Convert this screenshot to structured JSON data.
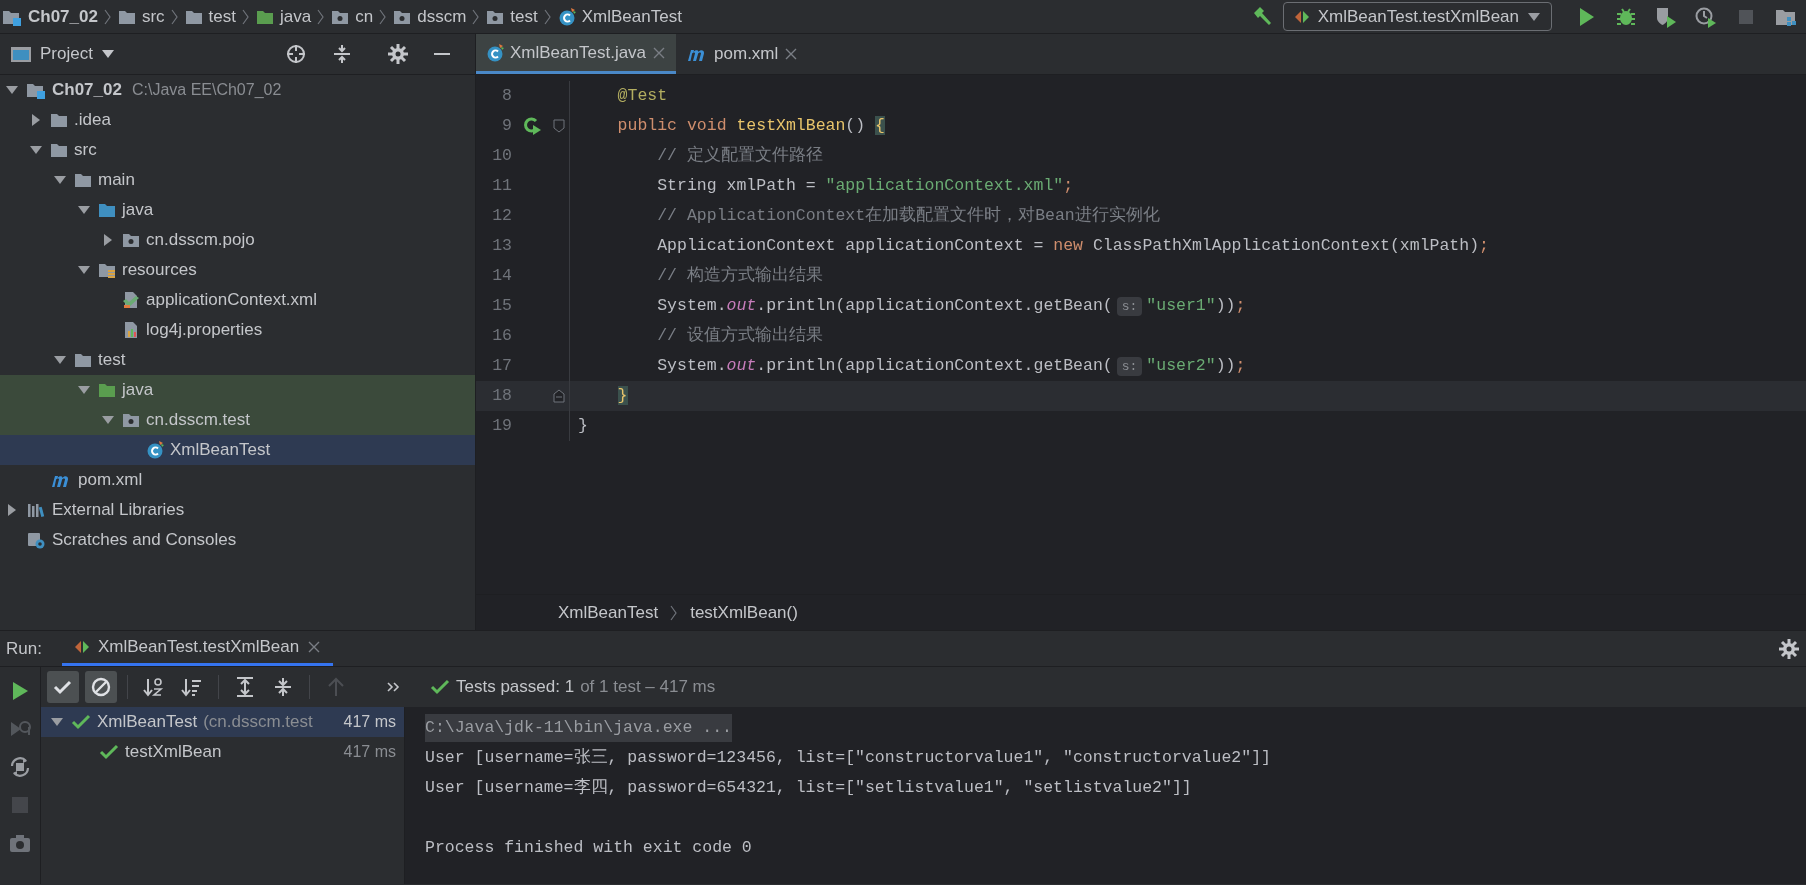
{
  "nav_bar": {
    "breadcrumbs": [
      {
        "label": "Ch07_02",
        "kind": "module"
      },
      {
        "label": "src",
        "kind": "folder"
      },
      {
        "label": "test",
        "kind": "folder"
      },
      {
        "label": "java",
        "kind": "test_folder"
      },
      {
        "label": "cn",
        "kind": "package"
      },
      {
        "label": "dsscm",
        "kind": "package"
      },
      {
        "label": "test",
        "kind": "package"
      },
      {
        "label": "XmlBeanTest",
        "kind": "class"
      }
    ],
    "run_config": "XmlBeanTest.testXmlBean",
    "actions": [
      {
        "kind": "run",
        "disabled": false
      },
      {
        "kind": "debug",
        "disabled": false
      },
      {
        "kind": "coverage",
        "disabled": false
      },
      {
        "kind": "profile",
        "disabled": false
      },
      {
        "kind": "stop",
        "disabled": true
      },
      {
        "kind": "structure",
        "disabled": false
      }
    ]
  },
  "project_panel": {
    "title": "Project",
    "tree": [
      {
        "label": "Ch07_02",
        "path": "C:\\Java EE\\Ch07_02",
        "kind": "module",
        "expanded": true,
        "selected": false,
        "test_scope": false,
        "children": [
          {
            "label": ".idea",
            "kind": "folder",
            "expanded": false,
            "selected": false,
            "test_scope": false
          },
          {
            "label": "src",
            "kind": "folder",
            "expanded": true,
            "selected": false,
            "test_scope": false,
            "children": [
              {
                "label": "main",
                "kind": "folder",
                "expanded": true,
                "selected": false,
                "test_scope": false,
                "children": [
                  {
                    "label": "java",
                    "kind": "source_folder",
                    "expanded": true,
                    "selected": false,
                    "test_scope": false,
                    "children": [
                      {
                        "label": "cn.dsscm.pojo",
                        "kind": "package",
                        "expanded": false,
                        "selected": false,
                        "test_scope": false
                      }
                    ]
                  },
                  {
                    "label": "resources",
                    "kind": "resources_folder",
                    "expanded": true,
                    "selected": false,
                    "test_scope": false,
                    "children": [
                      {
                        "label": "applicationContext.xml",
                        "kind": "xml",
                        "selected": false,
                        "test_scope": false
                      },
                      {
                        "label": "log4j.properties",
                        "kind": "properties",
                        "selected": false,
                        "test_scope": false
                      }
                    ]
                  }
                ]
              },
              {
                "label": "test",
                "kind": "folder",
                "expanded": true,
                "selected": false,
                "test_scope": false,
                "children": [
                  {
                    "label": "java",
                    "kind": "test_folder",
                    "expanded": true,
                    "selected": false,
                    "test_scope": true,
                    "children": [
                      {
                        "label": "cn.dsscm.test",
                        "kind": "package",
                        "expanded": true,
                        "selected": false,
                        "test_scope": true,
                        "children": [
                          {
                            "label": "XmlBeanTest",
                            "kind": "class",
                            "selected": true
                          }
                        ]
                      }
                    ]
                  }
                ]
              }
            ]
          },
          {
            "label": "pom.xml",
            "kind": "maven",
            "selected": false,
            "test_scope": false
          }
        ]
      },
      {
        "label": "External Libraries",
        "kind": "libraries",
        "expanded": false,
        "selected": false,
        "test_scope": false
      },
      {
        "label": "Scratches and Consoles",
        "kind": "scratches",
        "selected": false,
        "test_scope": false
      }
    ]
  },
  "editor": {
    "tabs": [
      {
        "label": "XmlBeanTest.java",
        "kind": "class",
        "selected": true
      },
      {
        "label": "pom.xml",
        "kind": "maven",
        "selected": false
      }
    ],
    "lines": [
      {
        "number": "8",
        "current": false,
        "tokens": [
          {
            "kind": "annotation",
            "text": "    @Test"
          }
        ]
      },
      {
        "number": "9",
        "current": false,
        "run_marker": true,
        "fold_open": true,
        "tokens": [
          {
            "kind": "keyword",
            "text": "    public void "
          },
          {
            "kind": "method",
            "text": "testXmlBean"
          },
          {
            "kind": "plain",
            "text": "() "
          },
          {
            "kind": "brace",
            "text": "{"
          }
        ]
      },
      {
        "number": "10",
        "current": false,
        "tokens": [
          {
            "kind": "comment",
            "text": "        // 定义配置文件路径"
          }
        ]
      },
      {
        "number": "11",
        "current": false,
        "tokens": [
          {
            "kind": "plain",
            "text": "        String xmlPath = "
          },
          {
            "kind": "string",
            "text": "\"applicationContext.xml\""
          },
          {
            "kind": "punct",
            "text": ";"
          }
        ]
      },
      {
        "number": "12",
        "current": false,
        "tokens": [
          {
            "kind": "comment",
            "text": "        // ApplicationContext在加载配置文件时，对Bean进行实例化"
          }
        ]
      },
      {
        "number": "13",
        "current": false,
        "tokens": [
          {
            "kind": "plain",
            "text": "        ApplicationContext applicationContext = "
          },
          {
            "kind": "keyword",
            "text": "new "
          },
          {
            "kind": "plain",
            "text": "ClassPathXmlApplicationContext(xmlPath)"
          },
          {
            "kind": "punct",
            "text": ";"
          }
        ]
      },
      {
        "number": "14",
        "current": false,
        "tokens": [
          {
            "kind": "comment",
            "text": "        // 构造方式输出结果"
          }
        ]
      },
      {
        "number": "15",
        "current": false,
        "tokens": [
          {
            "kind": "plain",
            "text": "        System."
          },
          {
            "kind": "field",
            "text": "out"
          },
          {
            "kind": "plain",
            "text": ".println(applicationContext.getBean("
          },
          {
            "kind": "hint",
            "text": "s:"
          },
          {
            "kind": "string",
            "text": "\"user1\""
          },
          {
            "kind": "plain",
            "text": "))"
          },
          {
            "kind": "punct",
            "text": ";"
          }
        ]
      },
      {
        "number": "16",
        "current": false,
        "tokens": [
          {
            "kind": "comment",
            "text": "        // 设值方式输出结果"
          }
        ]
      },
      {
        "number": "17",
        "current": false,
        "tokens": [
          {
            "kind": "plain",
            "text": "        System."
          },
          {
            "kind": "field",
            "text": "out"
          },
          {
            "kind": "plain",
            "text": ".println(applicationContext.getBean("
          },
          {
            "kind": "hint",
            "text": "s:"
          },
          {
            "kind": "string",
            "text": "\"user2\""
          },
          {
            "kind": "plain",
            "text": "))"
          },
          {
            "kind": "punct",
            "text": ";"
          }
        ]
      },
      {
        "number": "18",
        "current": true,
        "fold_close": true,
        "tokens": [
          {
            "kind": "brace",
            "text": "    }"
          }
        ]
      },
      {
        "number": "19",
        "current": false,
        "tokens": [
          {
            "kind": "plain",
            "text": "}"
          }
        ]
      }
    ],
    "breadcrumbs": [
      "XmlBeanTest",
      "testXmlBean()"
    ]
  },
  "run_panel": {
    "label": "Run:",
    "tabs": [
      {
        "label": "XmlBeanTest.testXmlBean",
        "selected": true
      }
    ],
    "side_actions": [
      {
        "kind": "rerun",
        "disabled": false
      },
      {
        "kind": "rerun_failed",
        "disabled": true
      },
      {
        "kind": "auto_test",
        "disabled": false
      },
      {
        "kind": "stop",
        "disabled": true
      },
      {
        "kind": "camera",
        "disabled": false
      }
    ],
    "toolbar": [
      {
        "kind": "show_passed",
        "on": true,
        "disabled": false
      },
      {
        "kind": "show_ignored",
        "on": true,
        "disabled": false
      },
      {
        "kind": "sort_alpha",
        "on": false,
        "disabled": false
      },
      {
        "kind": "sort_duration",
        "on": false,
        "disabled": false
      },
      {
        "kind": "expand_all",
        "on": false,
        "disabled": false
      },
      {
        "kind": "collapse_all",
        "on": false,
        "disabled": false
      },
      {
        "kind": "previous",
        "on": false,
        "disabled": true
      },
      {
        "kind": "more",
        "on": false,
        "disabled": false
      }
    ],
    "status": {
      "main": "Tests passed: 1",
      "detail": "of 1 test – 417 ms"
    },
    "tests": [
      {
        "label": "XmlBeanTest",
        "detail": "(cn.dsscm.test",
        "time": "417 ms",
        "passed": true,
        "selected": true,
        "expanded": true,
        "children": [
          {
            "label": "testXmlBean",
            "time": "417 ms",
            "passed": true,
            "selected": false
          }
        ]
      }
    ],
    "console": [
      {
        "kind": "command",
        "text": "C:\\Java\\jdk-11\\bin\\java.exe ..."
      },
      {
        "kind": "output",
        "text": "User [username=张三, password=123456, list=[\"constructorvalue1\", \"constructorvalue2\"]]"
      },
      {
        "kind": "output",
        "text": "User [username=李四, password=654321, list=[\"setlistvalue1\", \"setlistvalue2\"]]"
      },
      {
        "kind": "exit",
        "text": "Process finished with exit code 0"
      }
    ]
  }
}
